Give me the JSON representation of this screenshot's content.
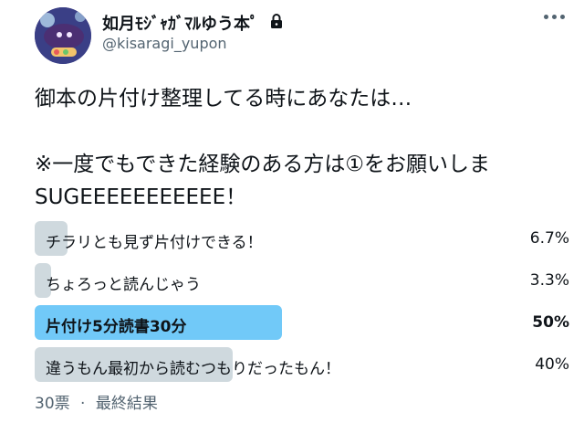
{
  "author": {
    "display_name": "如月ﾓｼﾞｬｶﾞﾏﾙゆう本ﾟ",
    "handle": "@kisaragi_yupon",
    "locked": true
  },
  "tweet": {
    "text": "御本の片付け整理してる時にあなたは…\n\n※一度でもできた経験のある方は①をお願いしまSUGEEEEEEEEEEE！"
  },
  "poll": {
    "options": [
      {
        "label": "チラリとも見ず片付けできる！",
        "percent": "6.7%",
        "value": 6.7,
        "winner": false
      },
      {
        "label": "ちょろっと読んじゃう",
        "percent": "3.3%",
        "value": 3.3,
        "winner": false
      },
      {
        "label": "片付け5分読書30分",
        "percent": "50%",
        "value": 50,
        "winner": true
      },
      {
        "label": "違うもん最初から読むつもりだったもん！",
        "percent": "40%",
        "value": 40,
        "winner": false
      }
    ],
    "votes": "30票",
    "separator": "·",
    "status": "最終結果"
  },
  "colors": {
    "bar": "#cfd9de",
    "winner_bar": "#71c9f8",
    "secondary_text": "#536471"
  },
  "icons": [
    "lock-icon",
    "more-icon"
  ]
}
